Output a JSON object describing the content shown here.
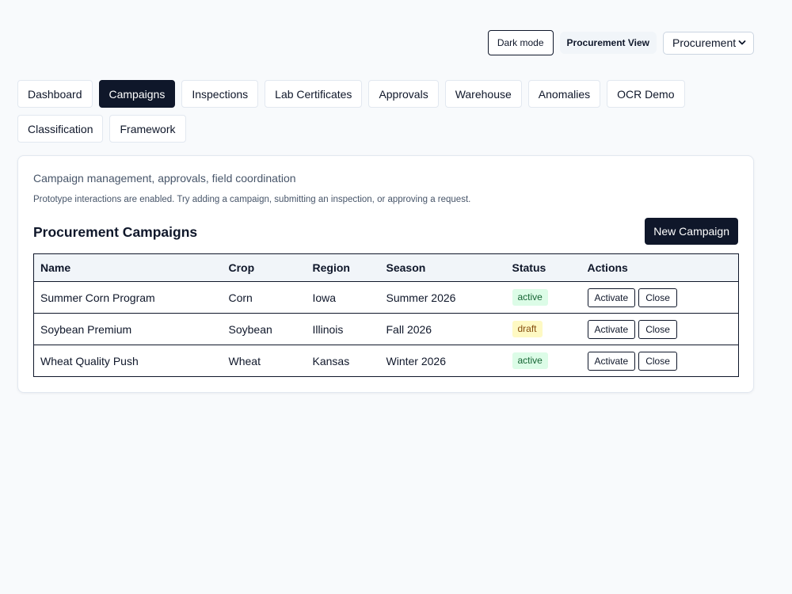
{
  "header": {
    "dark_mode_label": "Dark mode",
    "view_label": "Procurement View",
    "view_select": {
      "selected": "Procurement"
    }
  },
  "tabs": [
    {
      "label": "Dashboard",
      "active": false
    },
    {
      "label": "Campaigns",
      "active": true
    },
    {
      "label": "Inspections",
      "active": false
    },
    {
      "label": "Lab Certificates",
      "active": false
    },
    {
      "label": "Approvals",
      "active": false
    },
    {
      "label": "Warehouse",
      "active": false
    },
    {
      "label": "Anomalies",
      "active": false
    },
    {
      "label": "OCR Demo",
      "active": false
    },
    {
      "label": "Classification",
      "active": false
    },
    {
      "label": "Framework",
      "active": false
    }
  ],
  "main": {
    "subtitle": "Campaign management, approvals, field coordination",
    "note": "Prototype interactions are enabled. Try adding a campaign, submitting an inspection, or approving a request.",
    "title": "Procurement Campaigns",
    "new_button": "New Campaign",
    "columns": [
      "Name",
      "Crop",
      "Region",
      "Season",
      "Status",
      "Actions"
    ],
    "rows": [
      {
        "name": "Summer Corn Program",
        "crop": "Corn",
        "region": "Iowa",
        "season": "Summer 2026",
        "status": "active"
      },
      {
        "name": "Soybean Premium",
        "crop": "Soybean",
        "region": "Illinois",
        "season": "Fall 2026",
        "status": "draft"
      },
      {
        "name": "Wheat Quality Push",
        "crop": "Wheat",
        "region": "Kansas",
        "season": "Winter 2026",
        "status": "active"
      }
    ],
    "row_actions": {
      "activate": "Activate",
      "close": "Close"
    }
  },
  "colors": {
    "primary": "#0f172a",
    "active_badge_bg": "#dcfce7",
    "active_badge_text": "#166534",
    "draft_badge_bg": "#fef9c3",
    "draft_badge_text": "#854d0e"
  },
  "icons": {
    "select_arrow": "chevron-down-icon"
  }
}
